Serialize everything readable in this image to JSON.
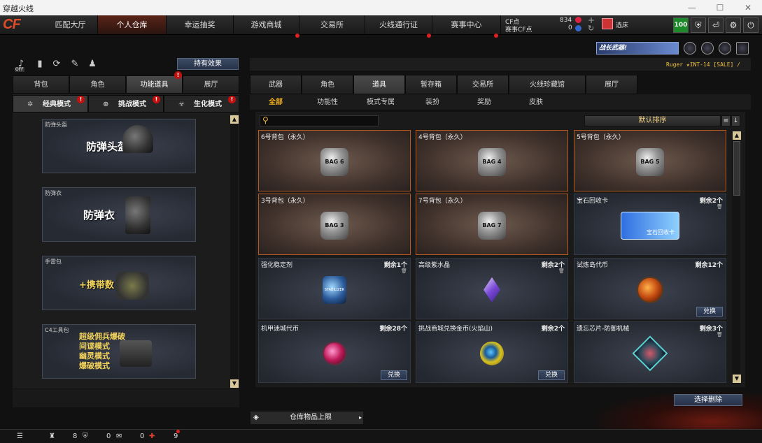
{
  "window": {
    "title": "穿越火线",
    "controls": [
      "—",
      "☐",
      "✕"
    ]
  },
  "logo": "CF",
  "nav": {
    "tabs": [
      {
        "label": "匹配大厅",
        "active": false,
        "dot": false
      },
      {
        "label": "个人仓库",
        "active": true,
        "dot": false
      },
      {
        "label": "幸运抽奖",
        "active": false,
        "dot": false
      },
      {
        "label": "游戏商城",
        "active": false,
        "dot": true
      },
      {
        "label": "交易所",
        "active": false,
        "dot": false
      },
      {
        "label": "火线通行证",
        "active": false,
        "dot": true
      },
      {
        "label": "赛事中心",
        "active": false,
        "dot": true
      }
    ],
    "cf_label": "CF点",
    "cf_value": "834",
    "event_cf_label": "赛事CF点",
    "event_cf_value": "0",
    "plus": "+",
    "refresh": "↻",
    "select_label": "选床",
    "level_badge": "100",
    "icons": [
      "shield-icon",
      "exit-icon",
      "gear-icon",
      "power-icon"
    ]
  },
  "left": {
    "effects_button": "持有效果",
    "toolbar_icons": [
      "sound-off-icon",
      "stats-icon",
      "history-icon",
      "tag-icon",
      "sprite-icon"
    ],
    "off_label": "OFF",
    "tabs": [
      {
        "label": "背包",
        "active": false
      },
      {
        "label": "角色",
        "active": false
      },
      {
        "label": "功能道具",
        "active": true,
        "warn": true
      },
      {
        "label": "展厅",
        "active": false
      }
    ],
    "modes": [
      {
        "label": "经典模式",
        "active": true,
        "warn": true
      },
      {
        "label": "挑战模式",
        "active": false,
        "warn": true
      },
      {
        "label": "生化模式",
        "active": false,
        "warn": true
      }
    ],
    "warn_mark": "!",
    "cards": [
      {
        "caption": "防弹头盔",
        "title": "防弹头盔"
      },
      {
        "caption": "防弹衣",
        "title": "防弹衣"
      },
      {
        "caption": "手雷包",
        "title": "+携带数"
      },
      {
        "caption": "C4工具包",
        "lines": [
          "超级佣兵爆破",
          "间谍模式",
          "幽灵模式",
          "爆破模式"
        ]
      }
    ]
  },
  "right": {
    "banner": "战长武器!",
    "subtitle": "Ruger ★INT-14 [SALE] /",
    "tabs": [
      {
        "label": "武器",
        "active": false
      },
      {
        "label": "角色",
        "active": false
      },
      {
        "label": "道具",
        "active": true
      },
      {
        "label": "暂存箱",
        "active": false
      },
      {
        "label": "交易所",
        "active": false
      },
      {
        "label": "火线珍藏馆",
        "active": false
      },
      {
        "label": "展厅",
        "active": false
      }
    ],
    "subtabs": [
      {
        "label": "全部",
        "active": true
      },
      {
        "label": "功能性",
        "active": false
      },
      {
        "label": "模式专属",
        "active": false
      },
      {
        "label": "装扮",
        "active": false
      },
      {
        "label": "奖励",
        "active": false
      },
      {
        "label": "皮肤",
        "active": false
      }
    ],
    "search_placeholder": "",
    "sort_label": "默认排序",
    "items": [
      {
        "name": "6号背包（永久）",
        "count": "",
        "bag": true,
        "art": "BAG 6",
        "exchange": ""
      },
      {
        "name": "4号背包（永久）",
        "count": "",
        "bag": true,
        "art": "BAG 4",
        "exchange": ""
      },
      {
        "name": "5号背包（永久）",
        "count": "",
        "bag": true,
        "art": "BAG 5",
        "exchange": ""
      },
      {
        "name": "3号背包（永久）",
        "count": "",
        "bag": true,
        "art": "BAG 3",
        "exchange": ""
      },
      {
        "name": "7号背包（永久）",
        "count": "",
        "bag": true,
        "art": "BAG 7",
        "exchange": ""
      },
      {
        "name": "宝石回收卡",
        "count": "剩余2个",
        "bag": false,
        "art": "宝石回收卡",
        "exchange": ""
      },
      {
        "name": "强化稳定剂",
        "count": "剩余1个",
        "bag": false,
        "art": "STABILIZER",
        "exchange": ""
      },
      {
        "name": "高级紫水晶",
        "count": "剩余2个",
        "bag": false,
        "art": "",
        "exchange": ""
      },
      {
        "name": "试炼岛代币",
        "count": "剩余12个",
        "bag": false,
        "art": "",
        "exchange": "兑换"
      },
      {
        "name": "机甲迷城代币",
        "count": "剩余28个",
        "bag": false,
        "art": "",
        "exchange": "兑换"
      },
      {
        "name": "挑战商城兑换金币(火焰山)",
        "count": "剩余2个",
        "bag": false,
        "art": "",
        "exchange": "兑换"
      },
      {
        "name": "遗忘芯片-防御机械",
        "count": "剩余3个",
        "bag": false,
        "art": "",
        "exchange": ""
      }
    ],
    "bulk_delete": "选择删除",
    "capacity_label": "仓库物品上限"
  },
  "status": {
    "friends_count": "8",
    "shield_count": "0",
    "chat_count": "0",
    "gift_count": "9"
  },
  "colors": {
    "accent": "#f0b020",
    "bag_border": "#b85a20",
    "alert": "#e02020"
  }
}
